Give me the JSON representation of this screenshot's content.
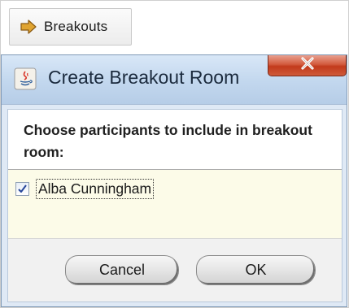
{
  "toolbar": {
    "breakouts_label": "Breakouts"
  },
  "dialog": {
    "title": "Create Breakout Room",
    "close_glyph": "X",
    "instructions": "Choose participants to include in breakout room:",
    "participants": [
      {
        "name": "Alba Cunningham",
        "checked": true
      }
    ],
    "cancel_label": "Cancel",
    "ok_label": "OK"
  },
  "colors": {
    "titlebar": "#c2d7ee",
    "close_button": "#c23a1c",
    "list_background": "#fcfbe8",
    "footer_background": "#f1f1f1",
    "arrow_icon": "#d49a2a"
  },
  "icons": [
    "arrow-right-icon",
    "java-app-icon",
    "close-icon",
    "checkmark-icon"
  ]
}
